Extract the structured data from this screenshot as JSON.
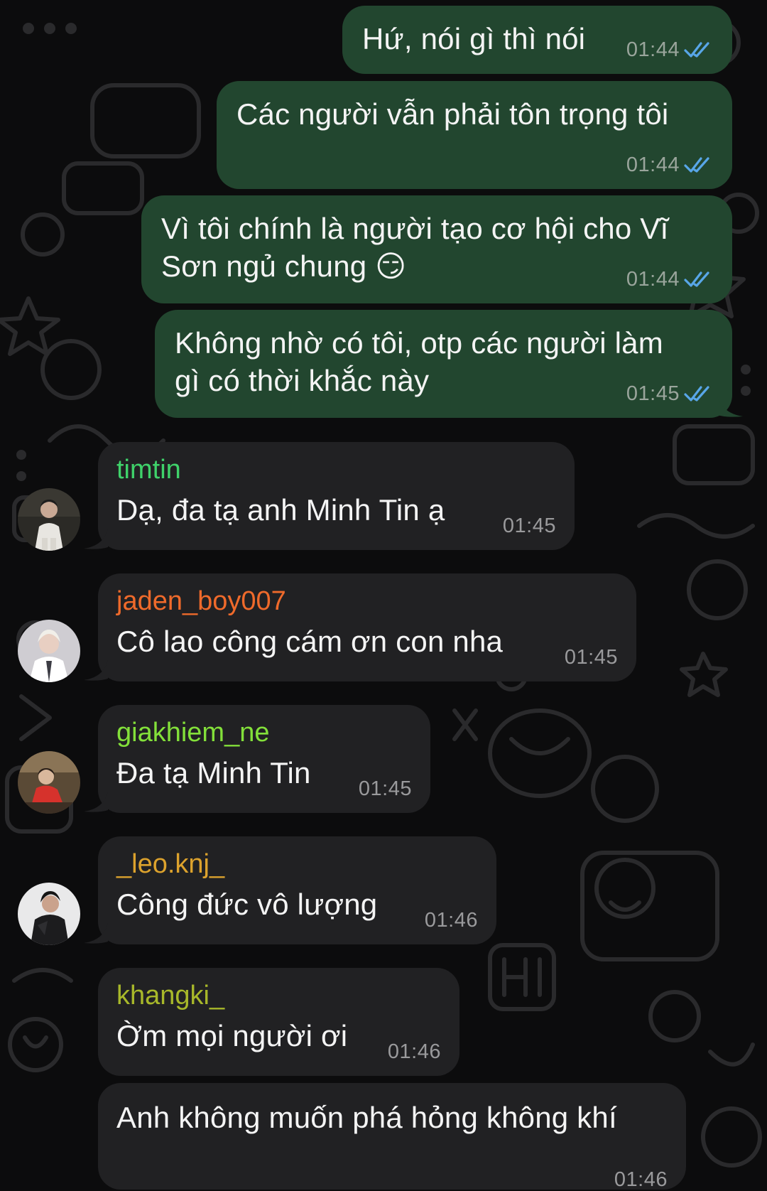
{
  "colors": {
    "background": "#0c0c0d",
    "outgoing_bubble": "#22462f",
    "incoming_bubble": "#212123",
    "read_check": "#58a6e8"
  },
  "messages": [
    {
      "direction": "outgoing",
      "text": "Hứ, nói gì thì nói",
      "time": "01:44",
      "status": "read-double-check-icon"
    },
    {
      "direction": "outgoing",
      "text": "Các người vẫn phải tôn trọng tôi",
      "time": "01:44",
      "status": "read-double-check-icon"
    },
    {
      "direction": "outgoing",
      "text": "Vì tôi chính là người tạo cơ hội cho Vĩ\nSơn ngủ chung 😏",
      "time": "01:44",
      "status": "read-double-check-icon"
    },
    {
      "direction": "outgoing",
      "text": "Không nhờ có tôi, otp các người làm\ngì có thời khắc này",
      "time": "01:45",
      "status": "read-double-check-icon"
    },
    {
      "direction": "incoming",
      "sender": "timtin",
      "sender_color": "#3fd26a",
      "text": "Dạ, đa tạ anh Minh Tin ạ",
      "time": "01:45"
    },
    {
      "direction": "incoming",
      "sender": "jaden_boy007",
      "sender_color": "#ef6a2b",
      "text": "Cô lao công cám ơn con nha",
      "time": "01:45"
    },
    {
      "direction": "incoming",
      "sender": "giakhiem_ne",
      "sender_color": "#83e03a",
      "text": "Đa tạ Minh Tin",
      "time": "01:45"
    },
    {
      "direction": "incoming",
      "sender": "_leo.knj_",
      "sender_color": "#dca22d",
      "text": "Công đức vô lượng",
      "time": "01:46"
    },
    {
      "direction": "incoming",
      "sender": "khangki_",
      "sender_color": "#a8b82a",
      "text": "Ờm mọi người ơi",
      "time": "01:46"
    },
    {
      "direction": "incoming",
      "text": "Anh không muốn phá hỏng không khí",
      "time": "01:46"
    }
  ]
}
